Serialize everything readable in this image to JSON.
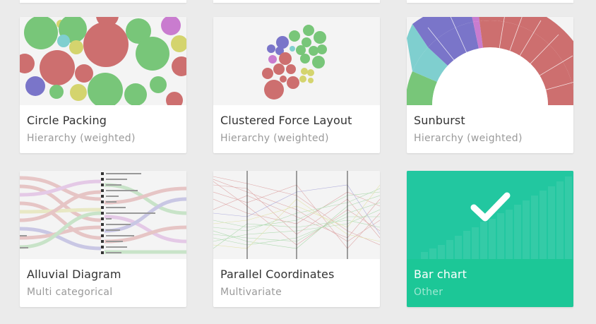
{
  "cards": [
    {
      "title": "Circle Packing",
      "subtitle": "Hierarchy (weighted)",
      "thumbnail": "circle-packing-thumbnail"
    },
    {
      "title": "Clustered Force Layout",
      "subtitle": "Hierarchy (weighted)",
      "thumbnail": "clustered-force-layout-thumbnail"
    },
    {
      "title": "Sunburst",
      "subtitle": "Hierarchy (weighted)",
      "thumbnail": "sunburst-thumbnail"
    },
    {
      "title": "Alluvial Diagram",
      "subtitle": "Multi categorical",
      "thumbnail": "alluvial-diagram-thumbnail"
    },
    {
      "title": "Parallel Coordinates",
      "subtitle": "Multivariate",
      "thumbnail": "parallel-coordinates-thumbnail"
    },
    {
      "title": "Bar chart",
      "subtitle": "Other",
      "thumbnail": "bar-chart-thumbnail",
      "selected": true,
      "selected_icon": "checkmark-icon"
    }
  ],
  "colors": {
    "background": "#ebebeb",
    "selected": "#1cc797",
    "green": "#78c679",
    "red": "#cd6f6f",
    "purple": "#7a75c9",
    "teal": "#7fcfcf",
    "yellow": "#d4d46e",
    "magenta": "#c97ccf"
  }
}
